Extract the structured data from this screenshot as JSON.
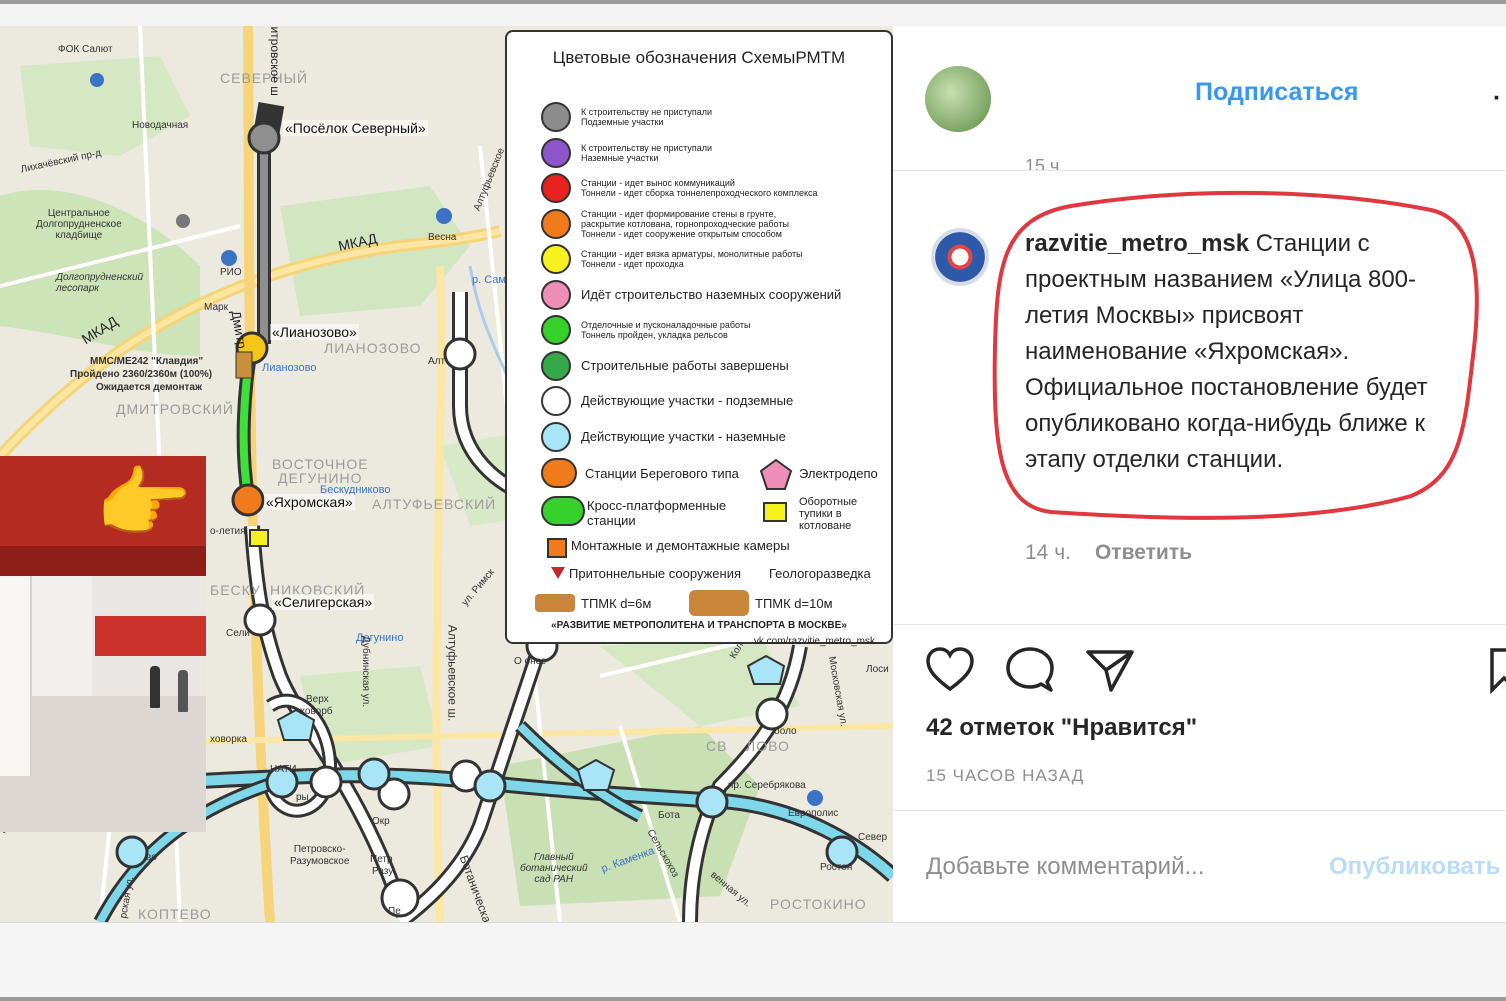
{
  "map": {
    "legend": {
      "title": "Цветовые обозначения СхемыРМТМ",
      "rows": [
        {
          "color": "#8c8c8c",
          "text": "К строительству не приступали\nПодземные участки"
        },
        {
          "color": "#8e54c9",
          "text": "К строительству не приступали\nНаземные участки"
        },
        {
          "color": "#e8231f",
          "text": "Станции - идет вынос коммуникаций\nТоннели - идет сборка тоннелепроходческого комплекса"
        },
        {
          "color": "#f07b1c",
          "text": "Станции - идет формирование стены в грунте,\nраскрытие котлована, горнопроходческие работы\nТоннели - идет сооружение открытым способом"
        },
        {
          "color": "#f7f11f",
          "text": "Станции - идет вязка арматуры, монолитные работы\nТоннели - идет проходка"
        },
        {
          "color": "#ef8fb8",
          "text": "Идёт строительство наземных сооружений"
        },
        {
          "color": "#37d12c",
          "text": "Отделочные и пусконаладочные работы\nТоннель пройден, укладка рельсов"
        },
        {
          "color": "#35a84a",
          "text": "Строительные работы завершены"
        },
        {
          "color": "#ffffff",
          "text": "Действующие участки - подземные"
        },
        {
          "color": "#a8e6f7",
          "text": "Действующие участки - наземные"
        }
      ],
      "extras": {
        "beregovoy": "Станции Берегового типа",
        "electrodepo": "Электродепо",
        "crossplatform": "Кросс-платформенные станции",
        "oborotnye": "Оборотные тупики в котловане",
        "kamery": "Монтажные и демонтажные камеры",
        "pritonnel": "Притоннельные сооружения",
        "geologo": "Геологоразведка",
        "tpmk6": "ТПМК d=6м",
        "tpmk10": "ТПМК d=10м",
        "footer1": "«РАЗВИТИЕ МЕТРОПОЛИТЕНА И ТРАНСПОРТА В МОСКВЕ»",
        "footer2": "vk.com/razvitie_metro_msk"
      }
    },
    "stations": {
      "severny": "«Посёлок Северный»",
      "lianozovo": "«Лианозово»",
      "yakhromskaya": "«Яхромская»",
      "seligerskaya": "«Селигерская»"
    },
    "districts": {
      "severny": "СЕВЕРНЫЙ",
      "lianozovo": "ЛИАНОЗОВО",
      "dmitrovsky": "ДМИТРОВСКИЙ",
      "vostochnoe": "ВОСТОЧНОЕ",
      "degunino": "ДЕГУНИНО",
      "altufevsky": "АЛТУФЬЕВСКИЙ",
      "beskudnikovsky_l": "БЕСКУ",
      "beskudnikovsky_r": "НИКОВСКИЙ",
      "koptevo": "КОПТЕВО",
      "rostokino": "РОСТОКИНО",
      "svibl": "СВ",
      "lovo": "ЛОВО"
    },
    "labels": {
      "fok": "ФОК Салют",
      "novodachnaya": "Новодачная",
      "likhachevsky": "Лихачёвский пр-д",
      "kladbishche": "Центральное\nДолгопрудненское\nкладбище",
      "mkad_top": "МКАД",
      "mkad_left": "МКАД",
      "vesna": "Весна",
      "rio": "РИО",
      "mark": "Марк",
      "lesopark": "Долгопрудненский\nлесопарк",
      "dmitr": "Дмитр",
      "kladiya_1": "ММС/МЕ242 \"Клавдия\"",
      "kladiya_2": "Пройдено 2360/2360м (100%)",
      "kladiya_3": "Ожидается демонтаж",
      "lianozovo_small": "Лианозово",
      "beskudnikovo": "Бескудниково",
      "degunino": "Дегунино",
      "dubninskaya": "Дубнинская ул.",
      "altufevskoe": "Алтуфьевское ш.",
      "altufevskoe_top": "Алтуфьевское",
      "rimsk": "ул. Римск",
      "r_sam": "р. Сам",
      "selig_frag": "Сели",
      "alt_frag": "Алт",
      "orp": "ОРП",
      "ohe": "О онсе",
      "verkh": "Верх",
      "hovorb": "ховорб",
      "khovorka": "ховорка",
      "nati": "НАТИ",
      "ory": "ры",
      "okr": "Окр",
      "petrovsko": "Петровско-\nРазумовское",
      "petr": "Петр",
      "razu": "Разу",
      "pe": "Пе",
      "bota": "Бота",
      "botanicheskaya": "Ботаническа",
      "glavny_sad": "Главный\nботанический\nсад РАН",
      "kamenka": "р. Каменка",
      "selskokhoz": "Сельскохоз",
      "vennaya": "венная ул.",
      "serebryakova": "пр. Серебрякова",
      "evropolis": "Европолис",
      "rostok": "Ростон",
      "sever": "Север",
      "losi": "Лоси",
      "kolskaya": "Кольская",
      "moskovskaya": "Московская ул.",
      "vo": "во",
      "bo": "во",
      "a_line": "о-летия",
      "bolo": "боло",
      "rskaya": "рская ул.",
      "shosse": "Дмитровское ш"
    }
  },
  "post": {
    "follow_label": "Подписаться",
    "more_label": "·",
    "cut_time": "15 ч.",
    "username": "razvitie_metro_msk",
    "caption": " Станции с проектным названием «Улица 800-летия Москвы» присвоят наименование «Яхромская». Официальное постановление будет опубликовано когда-нибудь ближе к этапу отделки станции.",
    "comment_time": "14 ч.",
    "reply_label": "Ответить",
    "likes": "42 отметок \"Нравится\"",
    "posted_ago": "15 ЧАСОВ НАЗАД",
    "add_comment_placeholder": "Добавьте комментарий...",
    "publish_label": "Опубликовать",
    "highlight_color": "#e0383e",
    "accent_color": "#3897f0"
  }
}
